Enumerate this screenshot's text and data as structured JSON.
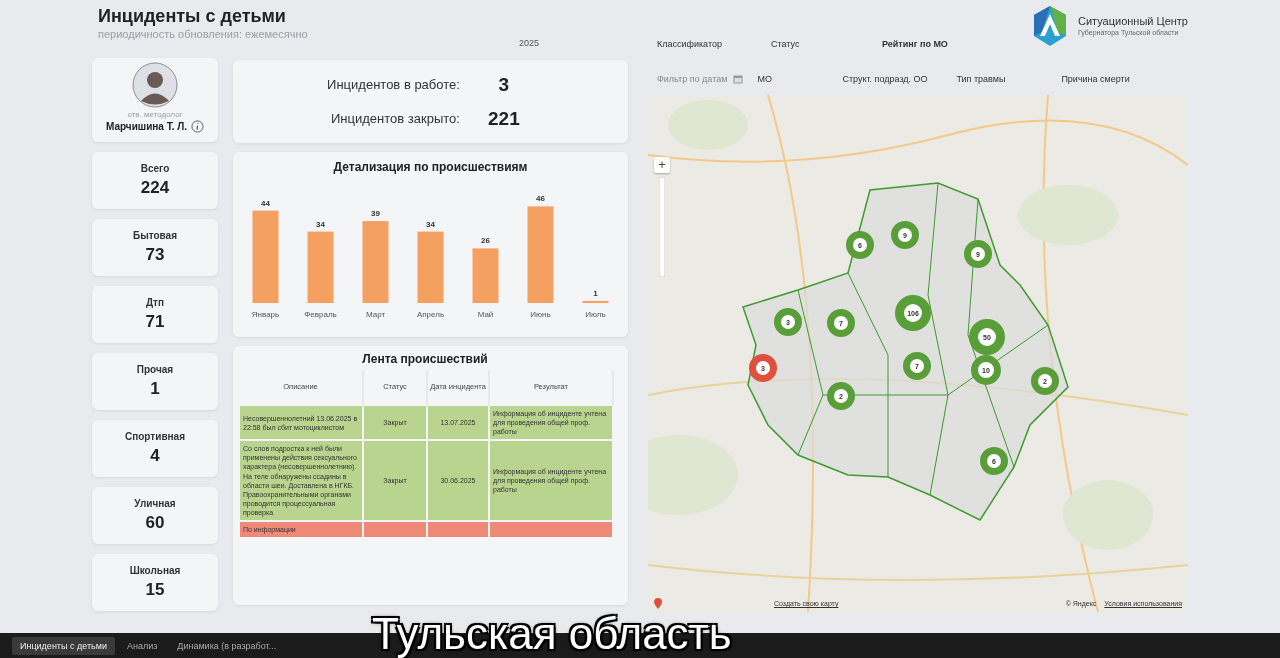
{
  "header": {
    "title": "Инциденты с детьми",
    "subtitle": "периодичность обновления: ежемесячно",
    "year_filter": "2025"
  },
  "filters": {
    "row_1": [
      "Классификатор",
      "Статус",
      "Рейтинг по МО"
    ],
    "row_2": [
      "Фильтр по датам",
      "МО",
      "Структ. подразд. ОО",
      "Тип травмы",
      "Причина смерти"
    ]
  },
  "logo": {
    "title": "Ситуационный Центр",
    "subtitle": "Губернатора Тульской области"
  },
  "profile": {
    "role": "отв. методолог",
    "name": "Марчишина Т. Л."
  },
  "stats": [
    {
      "label": "Всего",
      "value": "224"
    },
    {
      "label": "Бытовая",
      "value": "73"
    },
    {
      "label": "Дтп",
      "value": "71"
    },
    {
      "label": "Прочая",
      "value": "1"
    },
    {
      "label": "Спортивная",
      "value": "4"
    },
    {
      "label": "Уличная",
      "value": "60"
    },
    {
      "label": "Школьная",
      "value": "15"
    }
  ],
  "kpis": [
    {
      "label": "Инцидентов в работе:",
      "value": "3"
    },
    {
      "label": "Инцидентов закрыто:",
      "value": "221"
    }
  ],
  "chart": {
    "title": "Детализация по происшествиям",
    "chart_data": {
      "type": "bar",
      "categories": [
        "Январь",
        "Февраль",
        "Март",
        "Апрель",
        "Май",
        "Июнь",
        "Июль"
      ],
      "values": [
        44,
        34,
        39,
        34,
        26,
        46,
        1
      ],
      "data_labels": true
    }
  },
  "feed": {
    "title": "Лента происшествий",
    "columns": [
      "Описание",
      "Статус",
      "Дата инцидента",
      "Результат"
    ],
    "rows": [
      {
        "color": "#b8d48e",
        "description": "Несовершеннолетний 13.06.2025 в 22:58 был сбит мотоциклистом",
        "status": "Закрыт",
        "date": "13.07.2025",
        "result": "Информация об инциденте учтена для проведения общей проф. работы"
      },
      {
        "color": "#b8d48e",
        "description": "Со слов подростка к ней были применены действия сексуального характера (несовершеннолетнию). На теле обнаружены ссадины в области шеи. Доставлена в НГКБ. Правоохранительными органами проводится процессуальная проверка",
        "status": "Закрыт",
        "date": "30.06.2025",
        "result": "Информация об инциденте учтена для проведения общей проф. работы"
      },
      {
        "color": "#f08a78",
        "description": "По информации"
      }
    ]
  },
  "map": {
    "zoom_in": "+",
    "markers": [
      {
        "label": "6",
        "color": "#5a9e3a"
      },
      {
        "label": "9",
        "color": "#5a9e3a"
      },
      {
        "label": "9",
        "color": "#5a9e3a"
      },
      {
        "label": "3",
        "color": "#5a9e3a"
      },
      {
        "label": "7",
        "color": "#5a9e3a"
      },
      {
        "label": "106",
        "color": "#5a9e3a"
      },
      {
        "label": "50",
        "color": "#5a9e3a"
      },
      {
        "label": "3",
        "color": "#e0503f"
      },
      {
        "label": "7",
        "color": "#5a9e3a"
      },
      {
        "label": "10",
        "color": "#5a9e3a"
      },
      {
        "label": "2",
        "color": "#5a9e3a"
      },
      {
        "label": "2",
        "color": "#5a9e3a"
      },
      {
        "label": "6",
        "color": "#5a9e3a"
      }
    ],
    "create_link": "Создать свою карту",
    "copyright": "© Яндекс",
    "terms_link": "Условия использования"
  },
  "tabs": [
    {
      "label": "Инциденты с детьми",
      "selected": true
    },
    {
      "label": "Анализ",
      "selected": false
    },
    {
      "label": "Динамика (в разработ...",
      "selected": false
    }
  ],
  "caption": "Тульская область"
}
